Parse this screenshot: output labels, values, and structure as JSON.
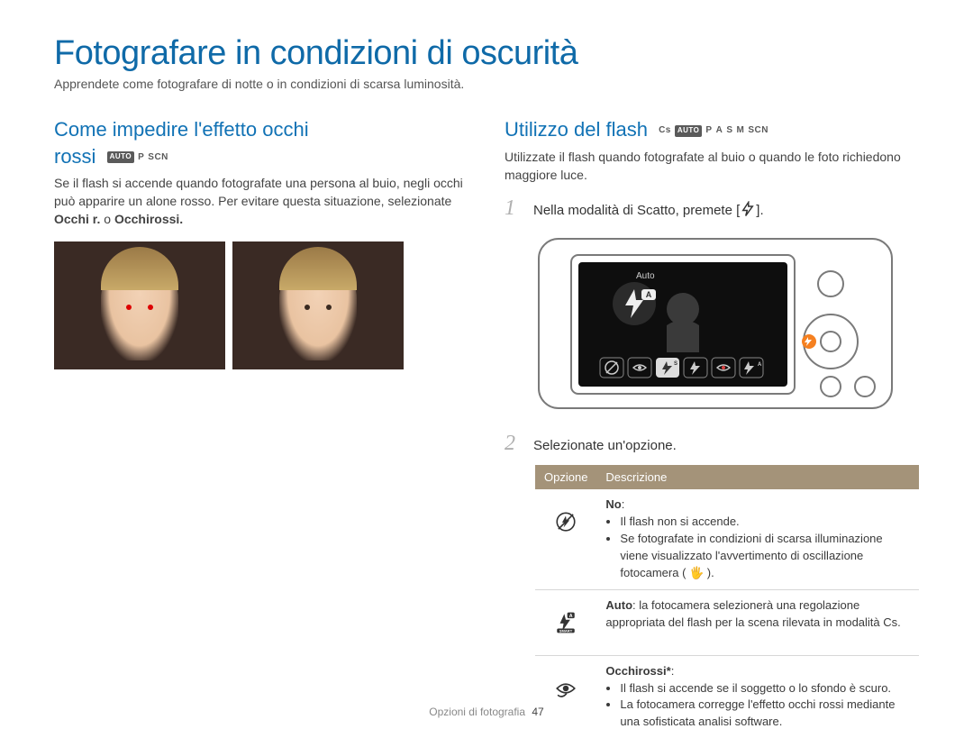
{
  "page": {
    "title": "Fotografare in condizioni di oscurità",
    "intro": "Apprendete come fotografare di notte o in condizioni di scarsa luminosità.",
    "footer_section": "Opzioni di fotografia",
    "page_number": "47"
  },
  "left": {
    "heading_line1": "Come impedire l'effetto occhi",
    "heading_line2": "rossi",
    "modes": [
      "AUTO",
      "P",
      "SCN"
    ],
    "body_part1": "Se il flash si accende quando fotografate una persona al buio, negli occhi può apparire un alone rosso. Per evitare questa situazione, selezionate ",
    "body_bold1": "Occhi r.",
    "body_mid": " o ",
    "body_bold2": "Occhirossi.",
    "image_labels": [
      "red-eye-example",
      "corrected-example"
    ]
  },
  "right": {
    "heading": "Utilizzo del flash",
    "modes": [
      "Cs",
      "AUTO",
      "P",
      "A",
      "S",
      "M",
      "SCN"
    ],
    "body": "Utilizzate il flash quando fotografate al buio o quando le foto richiedono maggiore luce.",
    "step1": "Nella modalità di Scatto, premete [",
    "step1_end": "].",
    "camera_screen_label": "Auto",
    "flash_icons": [
      "off",
      "redeye-fix",
      "slow-sync",
      "fill",
      "redeye",
      "auto"
    ],
    "step2": "Selezionate un'opzione.",
    "table": {
      "head_option": "Opzione",
      "head_desc": "Descrizione",
      "rows": [
        {
          "icon": "flash-off",
          "title": "No",
          "bullets": [
            "Il flash non si accende.",
            "Se fotografate in condizioni di scarsa illuminazione viene visualizzato l'avvertimento di oscillazione fotocamera ( 🖐 )."
          ]
        },
        {
          "icon": "flash-smart-auto",
          "title": "Auto",
          "desc": ": la fotocamera selezionerà una regolazione appropriata del flash per la scena rilevata in modalità Cs."
        },
        {
          "icon": "redeye-fix",
          "title": "Occhirossi*",
          "bullets": [
            "Il flash si accende se il soggetto o lo sfondo è scuro.",
            "La fotocamera corregge l'effetto occhi rossi mediante una sofisticata analisi software."
          ]
        }
      ]
    }
  }
}
